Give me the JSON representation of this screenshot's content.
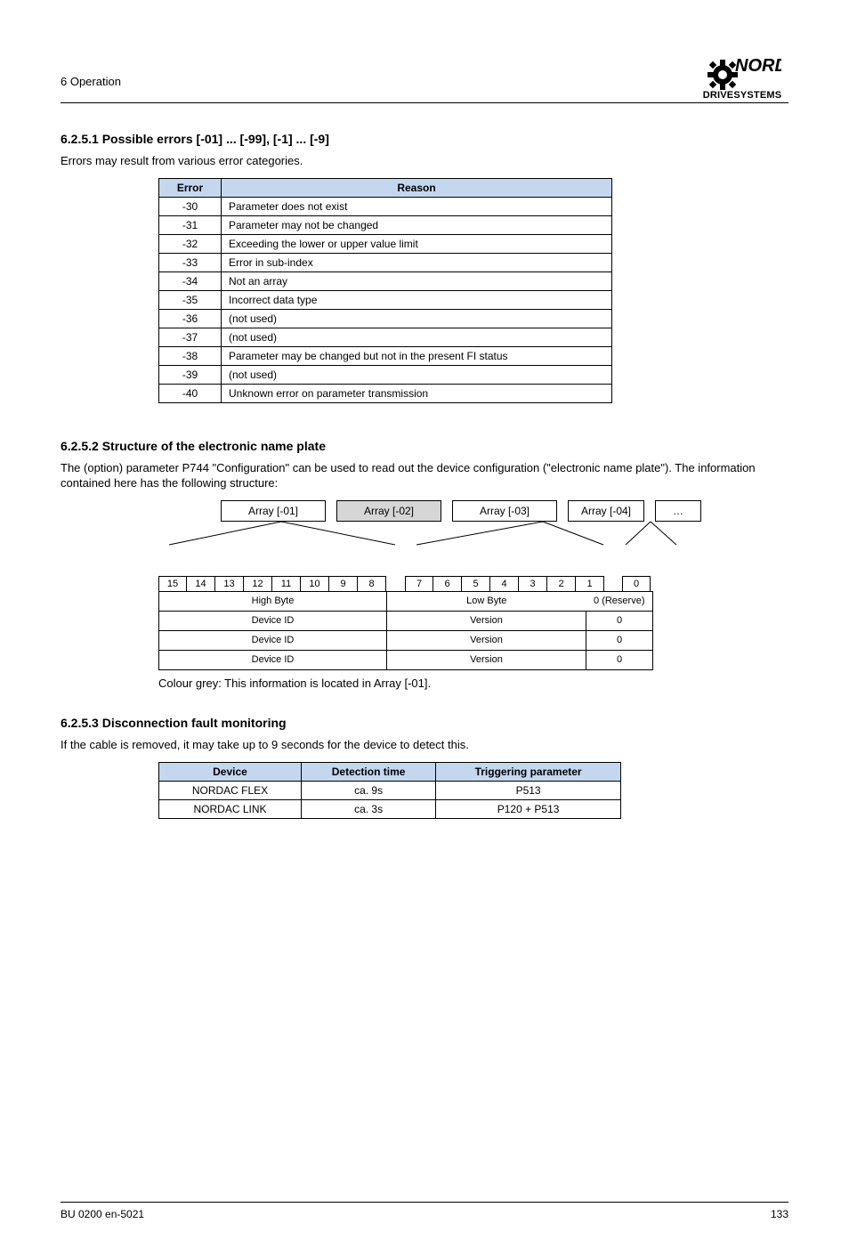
{
  "header": {
    "left": "6 Operation"
  },
  "logo": {
    "brand": "NORD",
    "sub": "DRIVESYSTEMS"
  },
  "section_errors": {
    "heading": "6.2.5.1   Possible errors [-01] ... [-99], [-1] ... [-9]",
    "intro": "Errors may result from various error categories.",
    "col1": "Error",
    "col2": "Reason",
    "rows": [
      [
        "-30",
        "Parameter does not exist"
      ],
      [
        "-31",
        "Parameter may not be changed"
      ],
      [
        "-32",
        "Exceeding the lower or upper value limit"
      ],
      [
        "-33",
        "Error in sub-index"
      ],
      [
        "-34",
        "Not an array"
      ],
      [
        "-35",
        "Incorrect data type"
      ],
      [
        "-36",
        "(not used)"
      ],
      [
        "-37",
        "(not used)"
      ],
      [
        "-38",
        "Parameter may be changed but not in the present FI status"
      ],
      [
        "-39",
        "(not used)"
      ],
      [
        "-40",
        "Unknown error on parameter transmission"
      ]
    ]
  },
  "section_struct": {
    "heading": "6.2.5.2   Structure of the electronic name plate",
    "intro": "The (option) parameter P744 \"Configuration\" can be used to read out the device configuration (\"electronic name plate\"). The information contained here has the following structure:",
    "labels": {
      "hb": "High Byte",
      "lb": "Low Byte",
      "rsv": "0 (Reserve)"
    },
    "color_note": "Colour grey: This information is located in Array [-01].",
    "top_boxes": [
      "Array [-01]",
      "Array [-02]",
      "Array [-03]",
      "Array [-04]"
    ],
    "byte_idx": [
      "15",
      "14",
      "13",
      "12",
      "11",
      "10",
      "9",
      "8",
      "7",
      "6",
      "5",
      "4",
      "3",
      "2",
      "1",
      "0"
    ],
    "rows": [
      [
        "Device ID",
        "Version",
        "0"
      ],
      [
        "Device ID",
        "Version",
        "0"
      ],
      [
        "Device ID",
        "Version",
        "0"
      ]
    ]
  },
  "section_disc": {
    "heading": "6.2.5.3   Disconnection fault monitoring",
    "intro": "If the cable is removed, it may take up to 9 seconds for the device to detect this.",
    "col1": "Device",
    "col2": "Detection time",
    "col3": "Triggering parameter",
    "rows": [
      [
        "NORDAC FLEX",
        "ca. 9s",
        "P513"
      ],
      [
        "NORDAC LINK",
        "ca. 3s",
        "P120 + P513"
      ]
    ]
  },
  "footer": {
    "left": "BU 0200 en-5021",
    "right": "133"
  }
}
